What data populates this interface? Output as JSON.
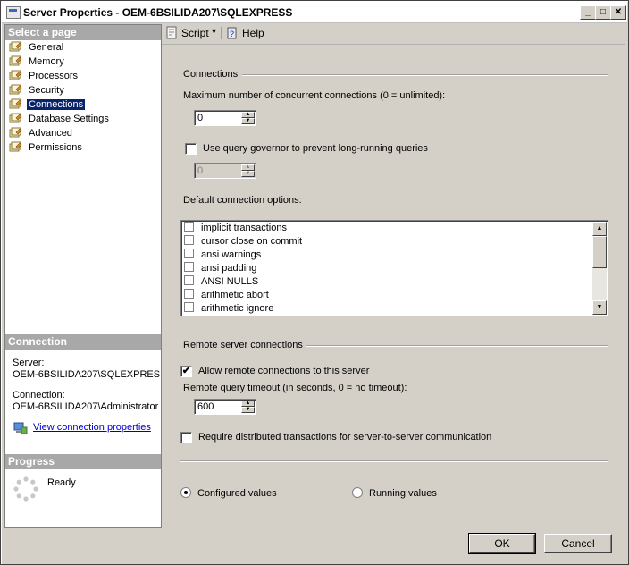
{
  "window": {
    "title": "Server Properties - OEM-6BSILIDA207\\SQLEXPRESS",
    "min_glyph": "_",
    "max_glyph": "□",
    "close_glyph": "✕"
  },
  "sidebar": {
    "header": "Select a page",
    "items": [
      {
        "label": "General"
      },
      {
        "label": "Memory"
      },
      {
        "label": "Processors"
      },
      {
        "label": "Security"
      },
      {
        "label": "Connections",
        "selected": true
      },
      {
        "label": "Database Settings"
      },
      {
        "label": "Advanced"
      },
      {
        "label": "Permissions"
      }
    ]
  },
  "connection": {
    "header": "Connection",
    "server_label": "Server:",
    "server_value": "OEM-6BSILIDA207\\SQLEXPRES",
    "connection_label": "Connection:",
    "connection_value": "OEM-6BSILIDA207\\Administrator",
    "view_link": "View connection properties"
  },
  "progress": {
    "header": "Progress",
    "status": "Ready"
  },
  "toolbar": {
    "script_label": "Script",
    "dropdown_glyph": "▾",
    "help_label": "Help"
  },
  "connections": {
    "group_label": "Connections",
    "max_conn_label": "Maximum number of concurrent connections (0 = unlimited):",
    "max_conn_value": "0",
    "use_governor_label": "Use query governor to prevent long-running queries",
    "use_governor_checked": false,
    "governor_value": "0",
    "default_options_label": "Default connection options:",
    "options": [
      {
        "label": "implicit transactions",
        "checked": false
      },
      {
        "label": "cursor close on commit",
        "checked": false
      },
      {
        "label": "ansi warnings",
        "checked": false
      },
      {
        "label": "ansi padding",
        "checked": false
      },
      {
        "label": "ANSI NULLS",
        "checked": false
      },
      {
        "label": "arithmetic abort",
        "checked": false
      },
      {
        "label": "arithmetic ignore",
        "checked": false
      }
    ]
  },
  "remote": {
    "group_label": "Remote server connections",
    "allow_label": "Allow remote connections to this server",
    "allow_checked": true,
    "timeout_label": "Remote query timeout (in seconds, 0 = no timeout):",
    "timeout_value": "600",
    "require_dist_label": "Require distributed transactions for server-to-server communication",
    "require_dist_checked": false
  },
  "values_mode": {
    "configured_label": "Configured values",
    "running_label": "Running values",
    "selected": "configured"
  },
  "buttons": {
    "ok": "OK",
    "cancel": "Cancel"
  },
  "colors": {
    "selection": "#0a246a",
    "section_header": "#a8a8a8",
    "link": "#0000cc",
    "dialog_bg": "#d4d0c8"
  },
  "checkmark": "✔"
}
